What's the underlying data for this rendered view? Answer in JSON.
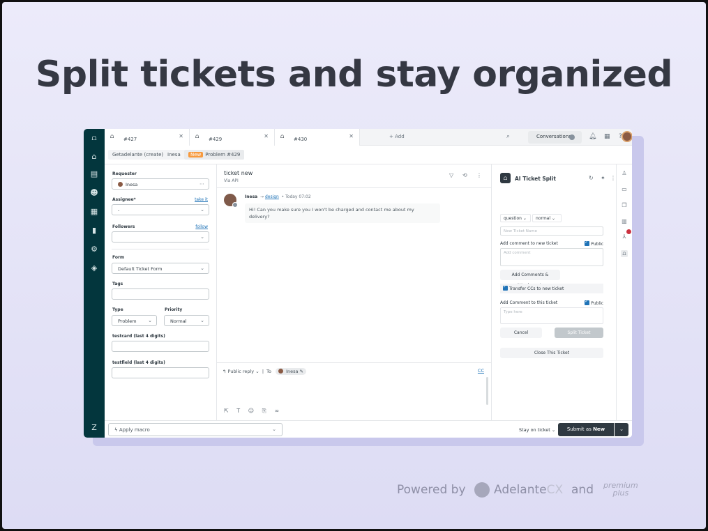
{
  "headline": "Split tickets and stay organized",
  "tabs": [
    {
      "label": "#427"
    },
    {
      "label": "#429"
    },
    {
      "label": "#430"
    }
  ],
  "add_tab": "+ Add",
  "conversations": "Conversations",
  "breadcrumbs": {
    "org": "Getadelante (create)",
    "user": "Inesa",
    "status_badge": "New",
    "ticket": "Problem #429"
  },
  "fields": {
    "requester_label": "Requester",
    "requester_value": "Inesa",
    "assignee_label": "Assignee*",
    "assignee_link": "take it",
    "assignee_value": "-",
    "followers_label": "Followers",
    "followers_link": "follow",
    "form_label": "Form",
    "form_value": "Default Ticket Form",
    "tags_label": "Tags",
    "type_label": "Type",
    "type_value": "Problem",
    "priority_label": "Priority",
    "priority_value": "Normal",
    "testcard_label": "testcard (last 4 digits)",
    "testfield_label": "testfield (last 4 digits)"
  },
  "conversation": {
    "title": "ticket new",
    "subtitle": "Via API",
    "author": "Inesa",
    "recipient": "design",
    "time": "Today 07:02",
    "message": "Hi! Can you make sure you I won't be charged and contact me about my delivery?"
  },
  "reply": {
    "mode": "Public reply",
    "to_label": "To",
    "to_value": "Inesa",
    "cc": "CC"
  },
  "ai_panel": {
    "title": "AI Ticket Split",
    "type_select": "question",
    "priority_select": "normal",
    "new_ticket_placeholder": "New Ticket Name",
    "comment_new_label": "Add comment to new ticket",
    "public_label": "Public",
    "comment_placeholder": "Add comment",
    "add_attachments_button": "Add Comments & Attachments",
    "transfer_cc_label": "Transfer CCs to new ticket",
    "comment_this_label": "Add Comment to this ticket",
    "public_label_2": "Public",
    "type_here_placeholder": "Type here",
    "cancel_button": "Cancel",
    "split_button": "Split Ticket",
    "close_button": "Close This Ticket"
  },
  "footer": {
    "macro": "Apply macro",
    "stay": "Stay on ticket",
    "submit_prefix": "Submit as",
    "submit_status": "New"
  },
  "branding": {
    "powered_by": "Powered by",
    "adelante": "Adelante",
    "cx": "CX",
    "and": "and",
    "premium_line1": "premium",
    "premium_line2": "plus"
  },
  "colors": {
    "rail": "#03363d",
    "accent_link": "#1f73b7",
    "new_badge": "#f79a3e",
    "submit_button": "#2f3941"
  }
}
